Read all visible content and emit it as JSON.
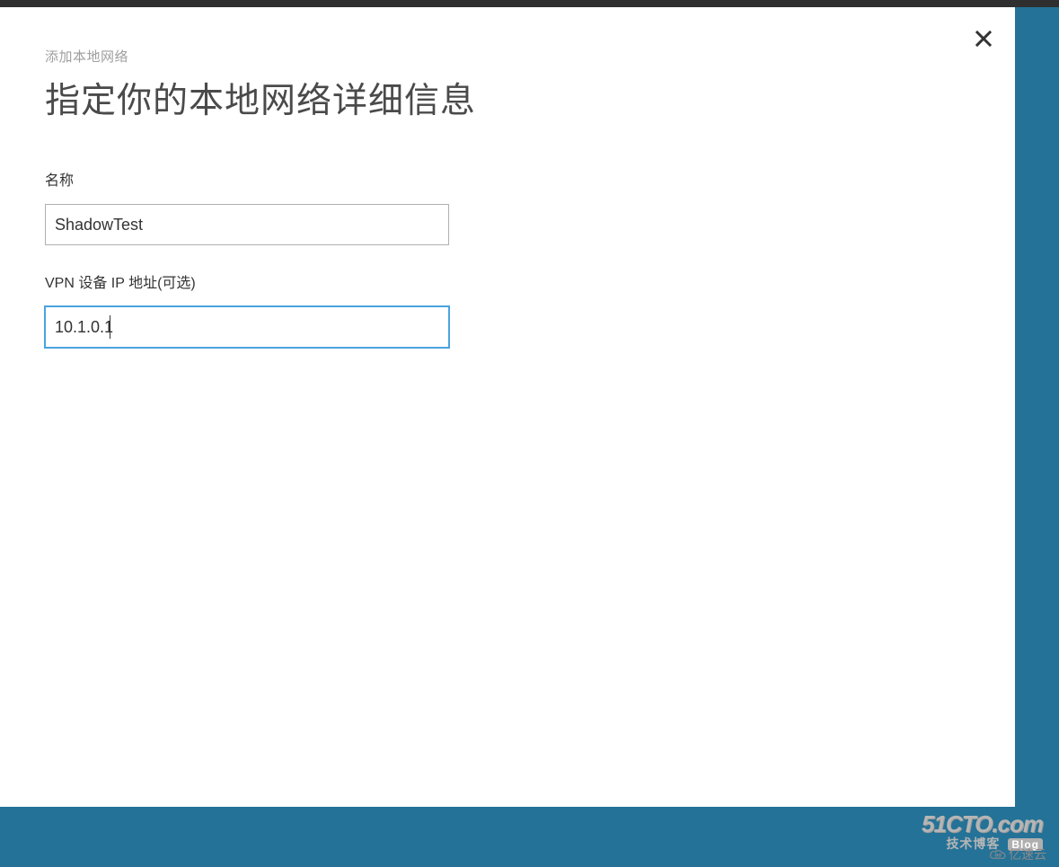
{
  "modal": {
    "breadcrumb": "添加本地网络",
    "title": "指定你的本地网络详细信息",
    "fields": {
      "name": {
        "label": "名称",
        "value": "ShadowTest"
      },
      "vpn_ip": {
        "label": "VPN 设备 IP 地址(可选)",
        "value": "10.1.0.1"
      }
    }
  },
  "watermarks": {
    "cto": {
      "line1": "51CTO.com",
      "line2_left": "技术博客",
      "line2_badge": "Blog"
    },
    "yisu": "亿速云"
  },
  "colors": {
    "accent": "#247297",
    "focus": "#4aa3df"
  }
}
